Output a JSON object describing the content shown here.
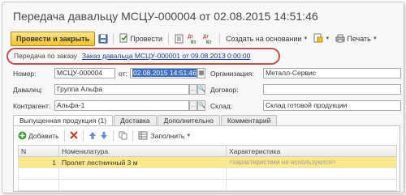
{
  "title": "Передача давальцу МСЦУ-000004 от 02.08.2015 14:51:46",
  "toolbar": {
    "post_close": "Провести и закрыть",
    "post": "Провести",
    "create_based": "Создать на основании",
    "print": "Печать"
  },
  "link_row": {
    "label": "Передача по заказу",
    "link": "Заказ давальца МСЦУ-000001 от 09.08.2013 0:00:00"
  },
  "form": {
    "number_label": "Номер:",
    "number_value": "МСЦУ-000004",
    "from_label": "от:",
    "date_value": "02.08.2015 14:51:46",
    "org_label": "Организация:",
    "org_value": "Металл-Сервис",
    "tolling_label": "Давалец:",
    "tolling_value": "Группа Альфа",
    "contract_label": "Договор:",
    "contract_value": "",
    "counterparty_label": "Контрагент:",
    "counterparty_value": "Альфа-1",
    "warehouse_label": "Склад:",
    "warehouse_value": "Склад готовой продукции"
  },
  "tabs": [
    {
      "label": "Выпущенная продукция (1)"
    },
    {
      "label": "Доставка"
    },
    {
      "label": "Дополнительно"
    },
    {
      "label": "Комментарий"
    }
  ],
  "panel_toolbar": {
    "add": "Добавить",
    "fill": "Заполнить"
  },
  "table": {
    "headers": [
      "N",
      "Номенклатура",
      "Характеристика"
    ],
    "rows": [
      {
        "n": "1",
        "item": "Пролет лестничный 3 м",
        "feature": "<характеристики не используются>"
      }
    ]
  },
  "colors": {
    "highlight_oval": "#c0504d",
    "primary_button": "#f2c230",
    "link": "#1c3d8a",
    "selected_row": "#fde98a"
  }
}
